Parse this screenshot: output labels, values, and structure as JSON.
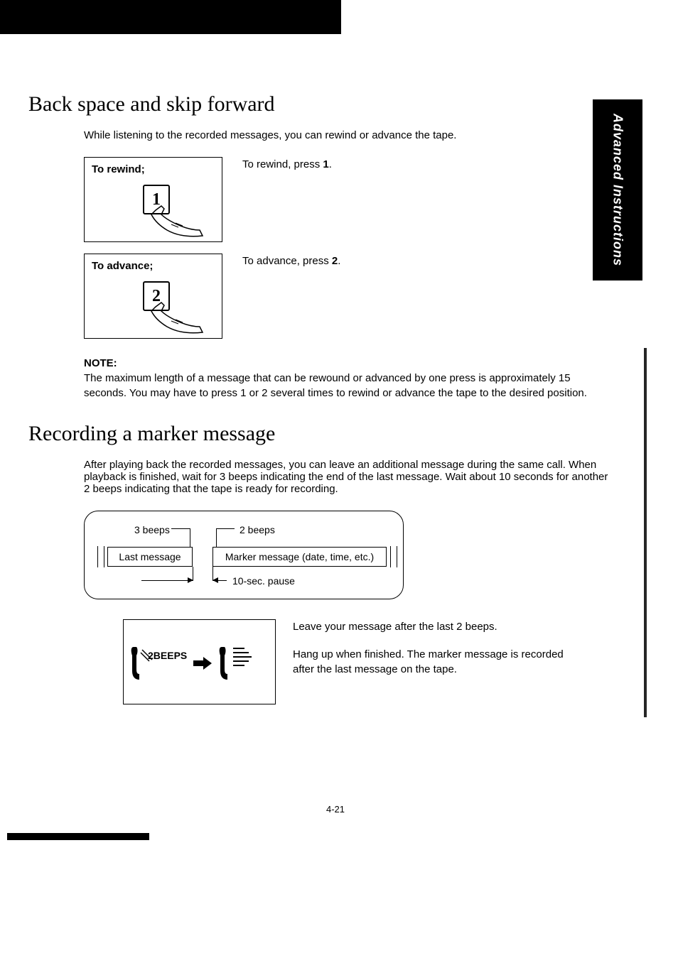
{
  "sideTab": "Advanced Instructions",
  "section1": {
    "title": "Back space and skip forward",
    "intro": "While listening to the recorded messages, you can rewind or advance the tape.",
    "rewind": {
      "boxLabel": "To rewind;",
      "key": "1",
      "text": "To rewind, press 1."
    },
    "advance": {
      "boxLabel": "To advance;",
      "key": "2",
      "text": "To advance, press 2."
    },
    "noteHeading": "NOTE:",
    "noteBody": "The maximum length of a message that can be rewound or advanced by one press is approximately 15 seconds. You may have to press 1 or 2 several times to rewind or advance the tape to the desired position."
  },
  "section2": {
    "title": "Recording a marker message",
    "intro": "After playing back the recorded messages, you can leave an additional message during the same call. When playback is finished, wait for 3 beeps indicating the end of the last message. Wait about 10 seconds for another 2 beeps indicating that the tape is ready for recording.",
    "diagram": {
      "label3beeps": "3 beeps",
      "label2beeps": "2 beeps",
      "lastMessage": "Last message",
      "markerMessage": "Marker message (date, time, etc.)",
      "pauseLabel": "10-sec. pause"
    },
    "markerFig": {
      "beeps": "2BEEPS"
    },
    "text1": "Leave your message after the last 2 beeps.",
    "text2": "Hang up when finished. The marker message is recorded after the last message on the tape."
  },
  "pageNumber": "4-21"
}
